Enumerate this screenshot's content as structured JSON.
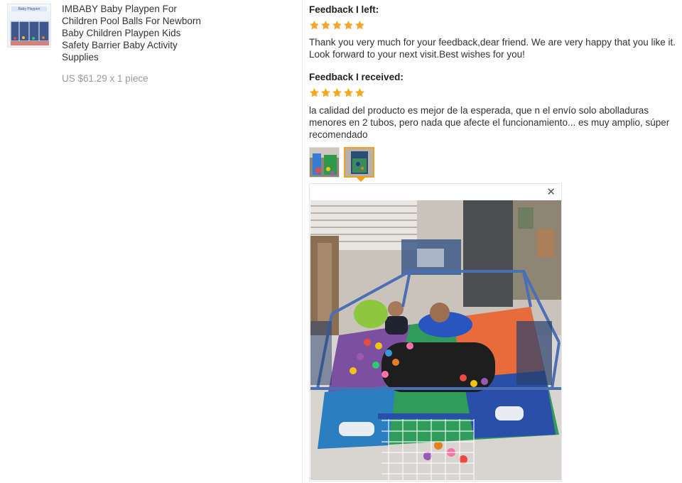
{
  "product": {
    "thumbnail_icon": "playpen-product-image",
    "thumbnail_caption": "Baby Playpen",
    "title": "IMBABY Baby Playpen For Children Pool Balls For Newborn Baby Children Playpen Kids Safety Barrier Baby Activity Supplies",
    "price_line": "US $61.29 x 1 piece"
  },
  "feedback_left": {
    "heading": "Feedback I left:",
    "stars": 5,
    "text": "Thank you very much for your feedback,dear friend. We are very happy that you like it. Look forward to your next visit.Best wishes for you!"
  },
  "feedback_received": {
    "heading": "Feedback I received:",
    "stars": 5,
    "text": "la calidad del producto es mejor de la esperada, que n el envío solo abolladuras menores en 2 tubos, pero nada que afecte el funcionamiento... es muy amplio, súper recomendado",
    "photos": [
      "photo-1",
      "photo-2"
    ],
    "selected_photo": 2
  },
  "viewer": {
    "close_glyph": "✕"
  },
  "colors": {
    "star": "#f5a623",
    "selected_border": "#f0a020",
    "price": "#999999"
  }
}
